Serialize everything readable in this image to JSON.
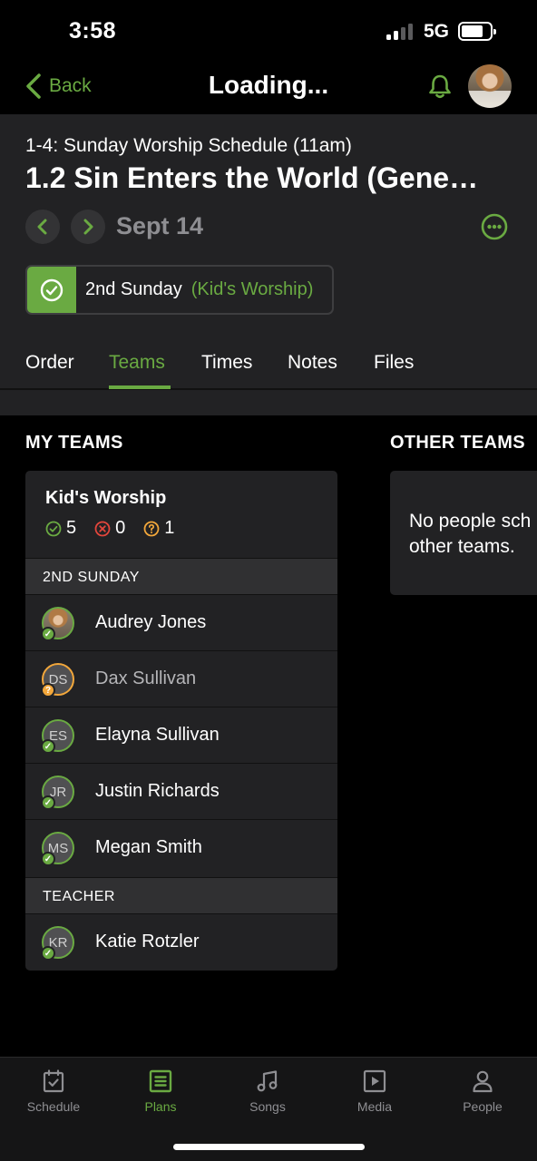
{
  "status_bar": {
    "time": "3:58",
    "network": "5G"
  },
  "nav": {
    "back_label": "Back",
    "title": "Loading..."
  },
  "plan": {
    "series": "1-4: Sunday Worship Schedule (11am)",
    "title": "1.2 Sin Enters the World (Gene…",
    "date": "Sept 14"
  },
  "time_pill": {
    "time_name": "2nd Sunday",
    "team_name": "(Kid's Worship)"
  },
  "tabs": [
    {
      "label": "Order"
    },
    {
      "label": "Teams"
    },
    {
      "label": "Times"
    },
    {
      "label": "Notes"
    },
    {
      "label": "Files"
    }
  ],
  "active_tab": "Teams",
  "my_teams": {
    "heading": "MY TEAMS",
    "team_name": "Kid's Worship",
    "counts": {
      "confirmed": "5",
      "declined": "0",
      "unconfirmed": "1"
    },
    "positions": [
      {
        "name": "2ND SUNDAY",
        "people": [
          {
            "initials": "",
            "name": "Audrey Jones",
            "status": "confirmed",
            "has_photo": true
          },
          {
            "initials": "DS",
            "name": "Dax Sullivan",
            "status": "unconfirmed",
            "has_photo": false
          },
          {
            "initials": "ES",
            "name": "Elayna Sullivan",
            "status": "confirmed",
            "has_photo": false
          },
          {
            "initials": "JR",
            "name": "Justin Richards",
            "status": "confirmed",
            "has_photo": false
          },
          {
            "initials": "MS",
            "name": "Megan Smith",
            "status": "confirmed",
            "has_photo": false
          }
        ]
      },
      {
        "name": "TEACHER",
        "people": [
          {
            "initials": "KR",
            "name": "Katie Rotzler",
            "status": "confirmed",
            "has_photo": false
          }
        ]
      }
    ]
  },
  "other_teams": {
    "heading": "OTHER TEAMS",
    "empty_line1": "No people sch",
    "empty_line2": "other teams."
  },
  "tab_bar": [
    {
      "label": "Schedule",
      "icon": "calendar-check-icon"
    },
    {
      "label": "Plans",
      "icon": "plans-list-icon"
    },
    {
      "label": "Songs",
      "icon": "music-note-icon"
    },
    {
      "label": "Media",
      "icon": "play-box-icon"
    },
    {
      "label": "People",
      "icon": "person-icon"
    }
  ],
  "active_bottom_tab": "Plans",
  "colors": {
    "accent": "#6aaa42",
    "warning": "#f2a73b",
    "danger": "#e2463c",
    "surface": "#222224",
    "background": "#000000"
  }
}
